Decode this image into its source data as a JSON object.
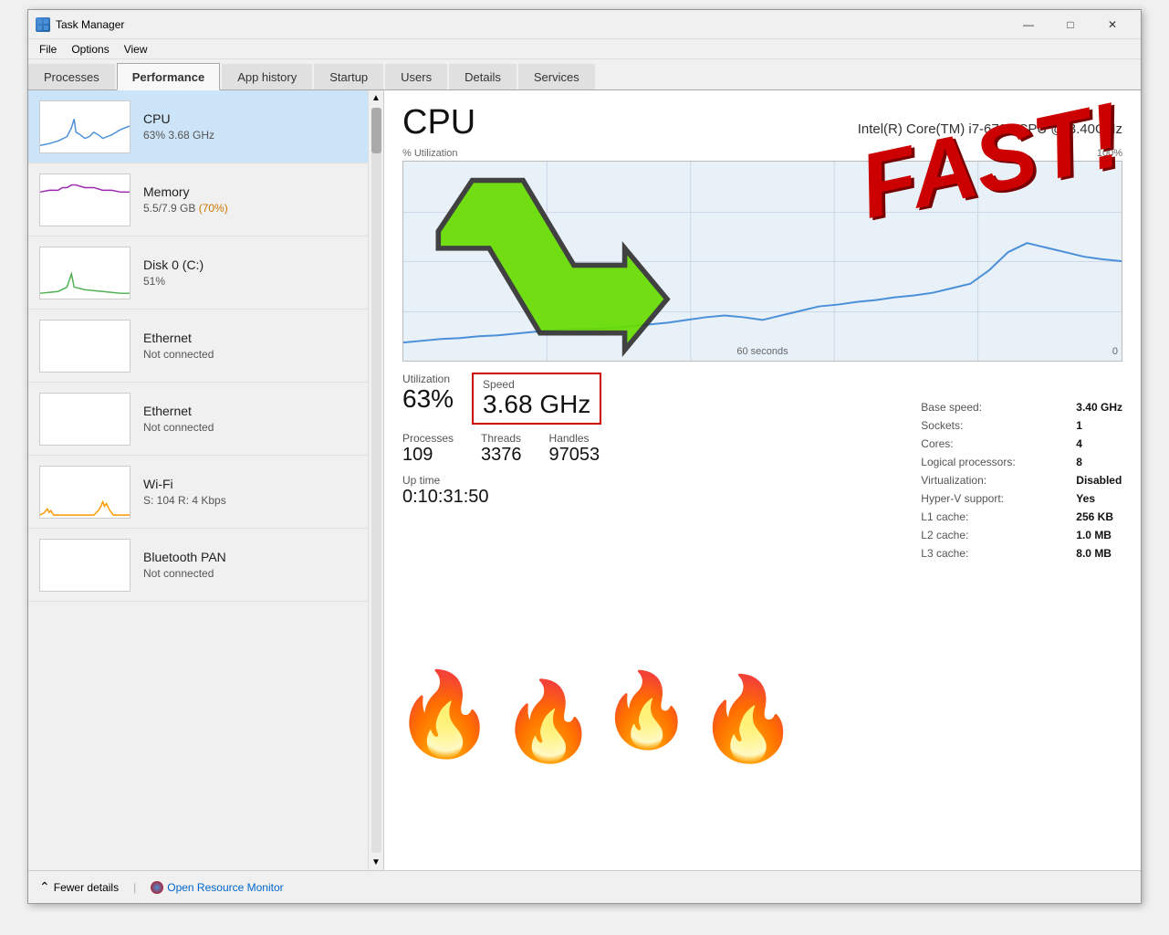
{
  "window": {
    "title": "Task Manager",
    "icon": "🖥"
  },
  "titlebar_buttons": {
    "minimize": "—",
    "maximize": "□",
    "close": "✕"
  },
  "menubar": {
    "items": [
      "File",
      "Options",
      "View"
    ]
  },
  "tabs": [
    {
      "id": "processes",
      "label": "Processes",
      "active": false
    },
    {
      "id": "performance",
      "label": "Performance",
      "active": true
    },
    {
      "id": "app-history",
      "label": "App history",
      "active": false
    },
    {
      "id": "startup",
      "label": "Startup",
      "active": false
    },
    {
      "id": "users",
      "label": "Users",
      "active": false
    },
    {
      "id": "details",
      "label": "Details",
      "active": false
    },
    {
      "id": "services",
      "label": "Services",
      "active": false
    }
  ],
  "sidebar": {
    "items": [
      {
        "id": "cpu",
        "name": "CPU",
        "stat": "63% 3.68 GHz",
        "active": true,
        "color": "#4a90d9"
      },
      {
        "id": "memory",
        "name": "Memory",
        "stat": "5.5/7.9 GB (70%)",
        "active": false,
        "color": "#9c27b0"
      },
      {
        "id": "disk",
        "name": "Disk 0 (C:)",
        "stat": "51%",
        "active": false,
        "color": "#4caf50"
      },
      {
        "id": "ethernet1",
        "name": "Ethernet",
        "stat": "Not connected",
        "active": false,
        "color": "#888"
      },
      {
        "id": "ethernet2",
        "name": "Ethernet",
        "stat": "Not connected",
        "active": false,
        "color": "#888"
      },
      {
        "id": "wifi",
        "name": "Wi-Fi",
        "stat": "S: 104 R: 4 Kbps",
        "active": false,
        "color": "#ff9800"
      },
      {
        "id": "bluetooth",
        "name": "Bluetooth PAN",
        "stat": "Not connected",
        "active": false,
        "color": "#888"
      }
    ]
  },
  "detail": {
    "title": "CPU",
    "model": "Intel(R) Core(TM) i7-6700 CPU @ 3.40GHz",
    "chart": {
      "y_label": "% Utilization",
      "y_max": "100%",
      "y_min": "0",
      "x_label": "60 seconds"
    },
    "stats": {
      "utilization_label": "Utilization",
      "utilization_value": "63%",
      "speed_label": "Speed",
      "speed_value": "3.68 GHz",
      "processes_label": "Processes",
      "processes_value": "109",
      "threads_label": "Threads",
      "threads_value": "3376",
      "handles_label": "Handles",
      "handles_value": "97053",
      "uptime_label": "Up time",
      "uptime_value": "0:10:31:50"
    },
    "info": {
      "base_speed_label": "Base speed:",
      "base_speed_value": "3.40 GHz",
      "sockets_label": "Sockets:",
      "sockets_value": "1",
      "cores_label": "Cores:",
      "cores_value": "4",
      "logical_processors_label": "Logical processors:",
      "logical_processors_value": "8",
      "virtualization_label": "Virtualization:",
      "virtualization_value": "Disabled",
      "hyper_v_label": "Hyper-V support:",
      "hyper_v_value": "Yes",
      "l1_cache_label": "L1 cache:",
      "l1_cache_value": "256 KB",
      "l2_cache_label": "L2 cache:",
      "l2_cache_value": "1.0 MB",
      "l3_cache_label": "L3 cache:",
      "l3_cache_value": "8.0 MB"
    }
  },
  "bottom": {
    "fewer_details_label": "Fewer details",
    "open_resource_monitor_label": "Open Resource Monitor"
  },
  "overlay": {
    "fast_text": "FAST!",
    "flame_emoji": "🔥"
  }
}
